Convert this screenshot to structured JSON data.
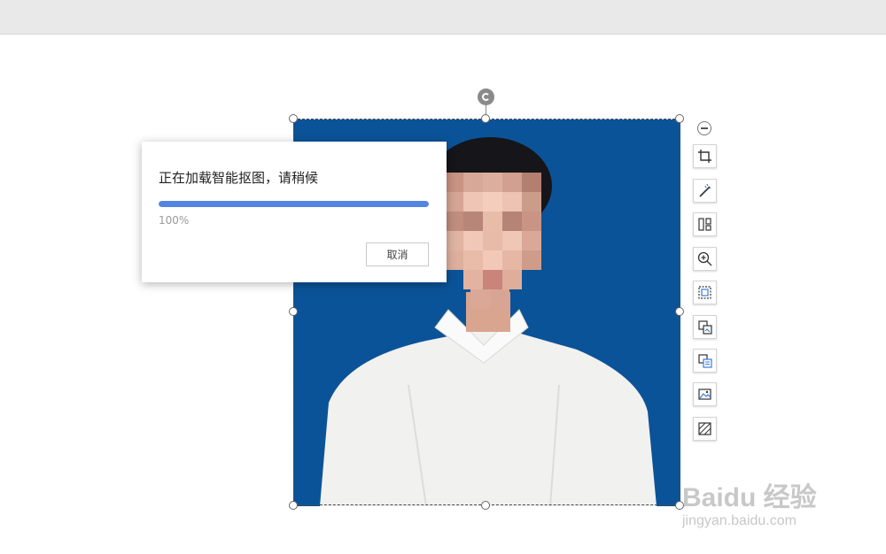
{
  "dialog": {
    "title": "正在加载智能抠图，请稍候",
    "progress_percent": 100,
    "progress_text": "100%",
    "cancel_label": "取消"
  },
  "image": {
    "background_color": "#0b5398",
    "subject": "portrait photo, white shirt, face pixelated"
  },
  "toolbar": {
    "tools": [
      "crop-icon",
      "magic-wand-icon",
      "split-image-icon",
      "zoom-in-icon",
      "fit-frame-icon",
      "replace-image-icon",
      "convert-image-icon",
      "picture-adjust-icon",
      "border-style-icon"
    ]
  },
  "watermark": {
    "main": "Baidu 经验",
    "sub": "jingyan.baidu.com"
  },
  "colors": {
    "accent": "#5385e0",
    "photo_bg": "#0b5398"
  }
}
